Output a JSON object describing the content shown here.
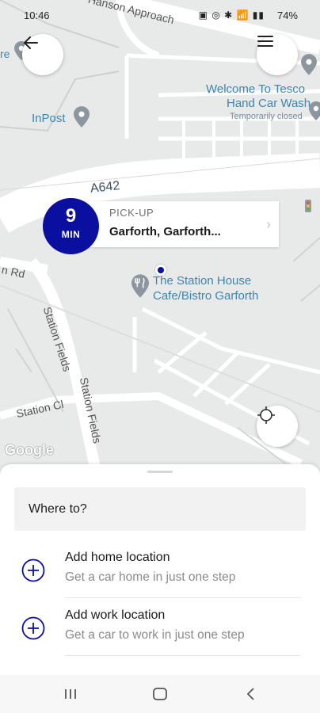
{
  "status_bar": {
    "time": "10:46",
    "icons": "▣ ◎ ✱ 📶 ▮▮",
    "battery": "74%"
  },
  "map": {
    "road_labels": {
      "approach": "Hanson Approach",
      "a642": "A642",
      "rd": "n Rd",
      "station_fields_1": "Station Fields",
      "station_fields_2": "Station Fields",
      "station_cl": "Station Cl"
    },
    "places": {
      "tesco_line1": "Welcome To Tesco",
      "tesco_line2": "Hand Car Wash",
      "tesco_status": "Temporarily closed",
      "inpost": "InPost",
      "cafe_line1": "The Station House",
      "cafe_line2": "Cafe/Bistro Garforth",
      "partial_left": "re"
    },
    "attribution": "Google"
  },
  "pickup": {
    "eta_value": "9",
    "eta_unit": "MIN",
    "label": "PICK-UP",
    "address": "Garforth, Garforth..."
  },
  "sheet": {
    "search_placeholder": "Where to?",
    "shortcuts": [
      {
        "title": "Add home location",
        "subtitle": "Get a car home in just one step"
      },
      {
        "title": "Add work location",
        "subtitle": "Get a car to work in just one step"
      }
    ]
  },
  "colors": {
    "brand": "#0b0f9f",
    "map_bg": "#e8e9e9",
    "road": "#ffffff"
  }
}
